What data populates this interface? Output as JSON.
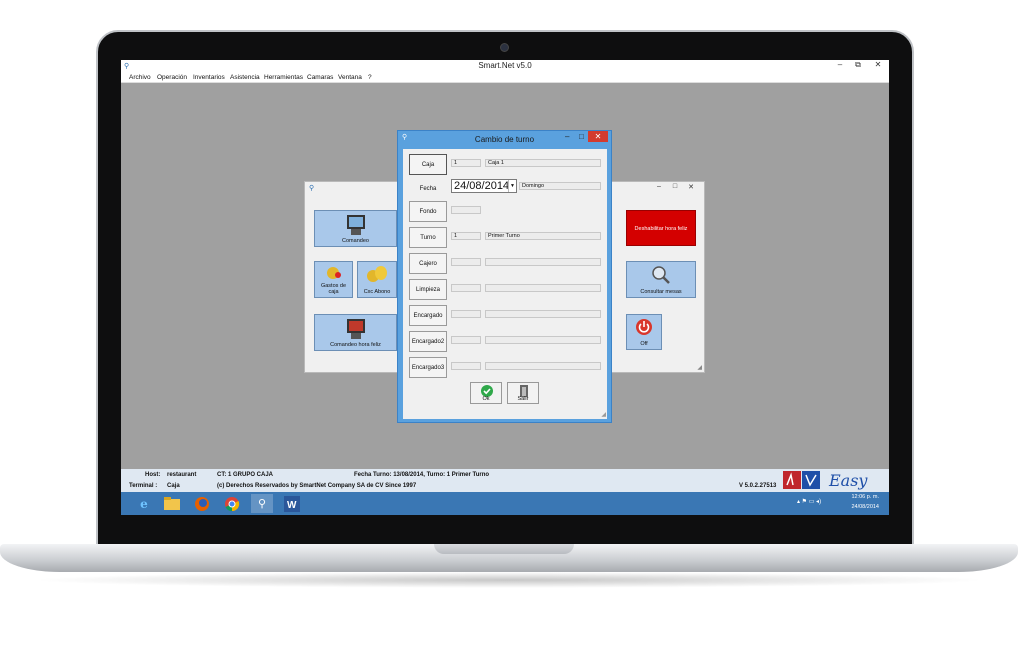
{
  "app": {
    "title": "Smart.Net v5.0",
    "window_buttons": {
      "minimize": "–",
      "restore": "⧉",
      "close": "✕"
    },
    "menu": [
      "Archivo",
      "Operación",
      "Inventarios",
      "Asistencia",
      "Herramientas",
      "Camaras",
      "Ventana",
      "?"
    ]
  },
  "left_panel": {
    "tiles": [
      {
        "label": "Comandeo",
        "icon": "pos-terminal-icon"
      },
      {
        "label": "Gastos de\ncaja",
        "icon": "money-bag-icon"
      },
      {
        "label": "Cxc Abono",
        "icon": "coins-icon"
      },
      {
        "label": "Comandeo hora feliz",
        "icon": "pos-happy-hour-icon"
      }
    ]
  },
  "right_panel": {
    "tiles": [
      {
        "label": "Deshabilitar hora feliz",
        "color": "#d40000"
      },
      {
        "label": "Consultar mesas",
        "icon": "magnifier-icon"
      },
      {
        "label": "Off",
        "icon": "power-icon"
      }
    ]
  },
  "dialog": {
    "title": "Cambio de turno",
    "fields": [
      {
        "button": "Caja",
        "code": "1",
        "text": "Caja 1"
      },
      {
        "button": "Fecha",
        "date": "24/08/2014",
        "text": "Domingo"
      },
      {
        "button": "Fondo",
        "code": "",
        "text": ""
      },
      {
        "button": "Turno",
        "code": "1",
        "text": "Primer Turno"
      },
      {
        "button": "Cajero",
        "code": "",
        "text": ""
      },
      {
        "button": "Limpieza",
        "code": "",
        "text": ""
      },
      {
        "button": "Encargado",
        "code": "",
        "text": ""
      },
      {
        "button": "Encargado2",
        "code": "",
        "text": ""
      },
      {
        "button": "Encargado3",
        "code": "",
        "text": ""
      }
    ],
    "ok_label": "Ok",
    "exit_label": "Salir"
  },
  "status": {
    "host_label": "Host:",
    "host_value": "restaurant",
    "terminal_label": "Terminal :",
    "terminal_value": "Caja",
    "ct": "CT: 1 GRUPO CAJA",
    "copyright": "(c) Derechos Reservados by SmartNet Company SA de CV Since 1997",
    "shift": "Fecha Turno: 13/08/2014, Turno: 1 Primer Turno",
    "version": "V 5.0.2.27513",
    "brand": "Easy"
  },
  "taskbar": {
    "time": "12:06 p. m.",
    "date": "24/08/2014"
  }
}
